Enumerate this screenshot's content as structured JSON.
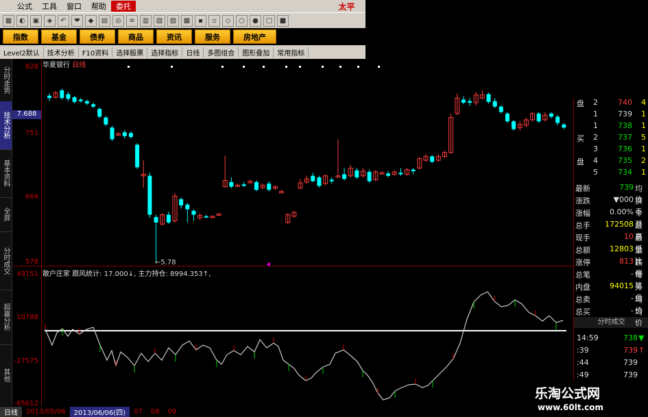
{
  "menu": {
    "items": [
      "公式",
      "工具",
      "窗口",
      "帮助"
    ],
    "active": "委托",
    "brand": "太平"
  },
  "nav": {
    "buttons": [
      "指数",
      "基金",
      "债券",
      "商品",
      "资讯",
      "服务",
      "房地产"
    ]
  },
  "funcbar": {
    "items": [
      "Level2默认",
      "技术分析",
      "F10资料",
      "选择股票",
      "选择指标",
      "日线",
      "多图组合",
      "图形叠加",
      "常用指标"
    ]
  },
  "left_tabs": [
    "分时走势",
    "技术分析",
    "基本资料",
    "全屏",
    "分时成交",
    "超赢分析",
    "其他"
  ],
  "chart": {
    "stock_name": "华夏银行",
    "period": "日线",
    "price_axis": [
      "828",
      "751",
      "664",
      "578"
    ],
    "current_price_tag": "7.688",
    "low_label": "5.78",
    "indicator_axis": [
      "49151",
      "10788",
      "-27575",
      "-65612"
    ],
    "indicator_head": "散户庄家  跟风统计: 17.000↓, 主力持仓: 8994.353↑,",
    "candles_up": "#ff3c3c",
    "candles_down": "#00ffff"
  },
  "bottom": {
    "items": [
      "日线",
      "2013/05/06",
      "2013/06/06(四)",
      "07",
      "08",
      "09"
    ]
  },
  "panel": {
    "book": [
      {
        "side": "盘",
        "lvl": "2",
        "price": "740",
        "vol": "4",
        "pc": "red"
      },
      {
        "side": "",
        "lvl": "1",
        "price": "739",
        "vol": "1",
        "pc": "wht"
      },
      {
        "side": "",
        "lvl": "1",
        "price": "738",
        "vol": "1",
        "pc": "grn"
      },
      {
        "side": "买",
        "lvl": "2",
        "price": "737",
        "vol": "5",
        "pc": "grn"
      },
      {
        "side": "",
        "lvl": "3",
        "price": "736",
        "vol": "1",
        "pc": "grn"
      },
      {
        "side": "盘",
        "lvl": "4",
        "price": "735",
        "vol": "2",
        "pc": "grn"
      },
      {
        "side": "",
        "lvl": "5",
        "price": "734",
        "vol": "1",
        "pc": "grn"
      }
    ],
    "stats": [
      {
        "k": "最新",
        "v": "739",
        "k2": "均价",
        "vc": "grn"
      },
      {
        "k": "涨跌",
        "v": "▼000",
        "k2": "换手",
        "vc": "wht"
      },
      {
        "k": "涨幅",
        "v": "0.00%",
        "k2": "今开",
        "vc": "wht"
      },
      {
        "k": "总手",
        "v": "172508",
        "k2": "最高",
        "vc": "yel"
      },
      {
        "k": "现手",
        "v": "10",
        "k2": "最低",
        "vc": "red"
      },
      {
        "k": "总额",
        "v": "12803",
        "k2": "量比",
        "vc": "yel"
      },
      {
        "k": "涨停",
        "v": "813",
        "k2": "跌停",
        "vc": "red"
      },
      {
        "k": "总笔",
        "v": "-",
        "k2": "每笔",
        "vc": "wht"
      },
      {
        "k": "内盘",
        "v": "94015",
        "k2": "外盘",
        "vc": "yel"
      },
      {
        "k": "总卖",
        "v": "-",
        "k2": "均价",
        "vc": "wht"
      },
      {
        "k": "总买",
        "v": "-",
        "k2": "均价",
        "vc": "wht"
      }
    ],
    "ticks_title": "分时成交",
    "ticks": [
      {
        "t": "14:59",
        "p": "738",
        "arrow": "▼",
        "pc": "grn"
      },
      {
        "t": ":39",
        "p": "739",
        "arrow": "↑",
        "pc": "red"
      },
      {
        "t": ":44",
        "p": "739",
        "arrow": "",
        "pc": "wht"
      },
      {
        "t": ":49",
        "p": "739",
        "arrow": "",
        "pc": "wht"
      }
    ]
  },
  "watermark": {
    "title": "乐淘公式网",
    "url": "www.60lt.com"
  }
}
